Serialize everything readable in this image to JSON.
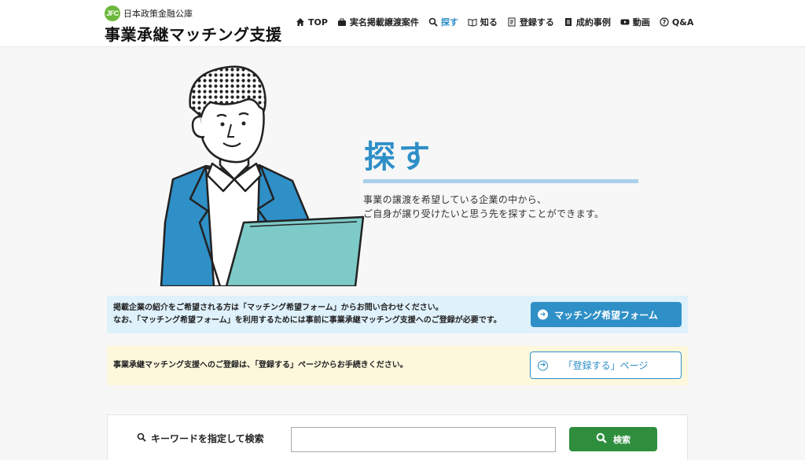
{
  "brand": {
    "logo_text": "JFC",
    "org_name": "日本政策金融公庫",
    "site_title": "事業承継マッチング支援"
  },
  "nav": {
    "items": [
      {
        "label": "TOP",
        "icon": "home-icon"
      },
      {
        "label": "実名掲載譲渡案件",
        "icon": "briefcase-icon"
      },
      {
        "label": "探す",
        "icon": "search-icon",
        "active": true
      },
      {
        "label": "知る",
        "icon": "book-icon"
      },
      {
        "label": "登録する",
        "icon": "form-icon"
      },
      {
        "label": "成約事例",
        "icon": "document-icon"
      },
      {
        "label": "動画",
        "icon": "video-icon"
      },
      {
        "label": "Q&A",
        "icon": "question-icon"
      }
    ]
  },
  "hero": {
    "title": "探す",
    "description_line1": "事業の譲渡を希望している企業の中から、",
    "description_line2": "ご自身が譲り受けたいと思う先を探すことができます。"
  },
  "notice_matching": {
    "line1": "掲載企業の紹介をご希望される方は「マッチング希望フォーム」からお問い合わせください。",
    "line2": "なお、「マッチング希望フォーム」を利用するためには事前に事業承継マッチング支援へのご登録が必要です。",
    "button_label": "マッチング希望フォーム"
  },
  "notice_register": {
    "text": "事業承継マッチング支援へのご登録は、「登録する」ページからお手続きください。",
    "button_label": "「登録する」ページ"
  },
  "search": {
    "label": "キーワードを指定して検索",
    "input_value": "",
    "button_label": "検索"
  },
  "colors": {
    "accent_blue": "#2f8fc7",
    "search_green": "#2e8e3e",
    "logo_green": "#6cb83a",
    "notice_blue_bg": "#dff1fb",
    "notice_yellow_bg": "#fdf8dc"
  }
}
